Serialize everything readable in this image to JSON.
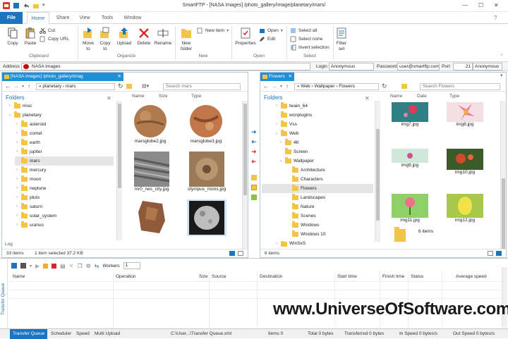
{
  "window": {
    "title": "SmartFTP - [NASA Images] /photo_gallery/image/planetary/mars/",
    "min": "—",
    "max": "☐",
    "close": "✕"
  },
  "ribbon_tabs": [
    "File",
    "Home",
    "Share",
    "View",
    "Tools",
    "Window"
  ],
  "ribbon": {
    "copy": "Copy",
    "paste": "Paste",
    "cut": "Cut",
    "copy_url": "Copy URL",
    "clipboard": "Clipboard",
    "move_to": "Move to",
    "copy_to": "Copy to",
    "upload": "Upload",
    "delete": "Delete",
    "rename": "Rename",
    "organize": "Organize",
    "new_folder": "New folder",
    "new_item": "New item",
    "new": "New",
    "properties": "Properties",
    "open": "Open",
    "edit": "Edit",
    "open_group": "Open",
    "select_all": "Select all",
    "select_none": "Select none",
    "invert_selection": "Invert selection",
    "select": "Select",
    "filter_set": "Filter set"
  },
  "address": {
    "label": "Address",
    "value": "NASA Images",
    "login_label": "Login",
    "login_value": "Anonymous",
    "password_label": "Password",
    "password_value": "user@smartftp.com",
    "port_label": "Port",
    "port_value": "21",
    "mode_value": "Anonymous"
  },
  "left_pane": {
    "tab": "[NASA Images] /photo_gallery/imag",
    "crumbs": "« planetary › mars",
    "search": "Search mars",
    "folders": "Folders",
    "col_name": "Name",
    "col_size": "Size",
    "col_type": "Type",
    "tree": [
      "misc",
      "planetary",
      "asteroid",
      "comet",
      "earth",
      "jupiter",
      "mars",
      "mercury",
      "moon",
      "neptune",
      "pluto",
      "saturn",
      "solar_system",
      "uranus"
    ],
    "thumbs": [
      "marsglobe2.jpg",
      "marsglobe3.jpg",
      "mr0_nes_city.jpg",
      "olympus_mons.jpg",
      "",
      ""
    ],
    "log": "Log",
    "status_items": "33 items",
    "status_sel": "1 item selected  37.2 KB"
  },
  "right_pane": {
    "tab": "Flowers",
    "crumbs": "« Web › Wallpaper › Flowers",
    "search": "Search Flowers",
    "folders": "Folders",
    "col_name": "Name",
    "col_date": "Date",
    "col_type": "Type",
    "tree": [
      "twain_64",
      "wcnplugins",
      "Vss",
      "Web",
      "4K",
      "Screen",
      "Wallpaper",
      "Architecture",
      "Characters",
      "Flowers",
      "Landscapes",
      "Nature",
      "Scenes",
      "Windows",
      "Windows 10",
      "WinSxS"
    ],
    "thumbs": [
      "img7.jpg",
      "img8.jpg",
      "img9.jpg",
      "img10.jpg",
      "img11.jpg",
      "img12.jpg"
    ],
    "items_label": "6 items",
    "status_items": "6 items"
  },
  "queue": {
    "title": "Transfer Queue",
    "workers_label": "Workers",
    "workers_value": "1",
    "cols": [
      "Name",
      "Operation",
      "Size",
      "Source",
      "Destination",
      "Start time",
      "Finish time",
      "Status",
      "Average speed"
    ]
  },
  "bottom": {
    "tabs": [
      "Transfer Queue",
      "Scheduler",
      "Speed",
      "Multi Upload"
    ],
    "path": "C:\\User...\\Transfer Queue.xml",
    "items": "Items 0",
    "total": "Total 0 bytes",
    "transferred": "Transferred 0 bytes",
    "in_speed": "In Speed 0 bytes/s",
    "out_speed": "Out Speed 0 bytes/s"
  },
  "watermark": "www.UniverseOfSoftware.com",
  "colors": {
    "accent": "#1e73be",
    "pane_tab": "#1e90d8",
    "folder": "#f3c547"
  }
}
